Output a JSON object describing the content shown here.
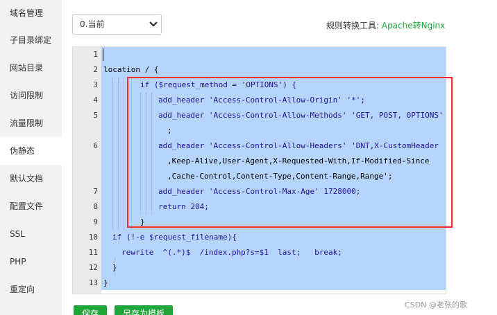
{
  "sidebar": {
    "items": [
      {
        "label": "域名管理"
      },
      {
        "label": "子目录绑定"
      },
      {
        "label": "网站目录"
      },
      {
        "label": "访问限制"
      },
      {
        "label": "流量限制"
      },
      {
        "label": "伪静态",
        "active": true
      },
      {
        "label": "默认文档"
      },
      {
        "label": "配置文件"
      },
      {
        "label": "SSL"
      },
      {
        "label": "PHP"
      },
      {
        "label": "重定向"
      }
    ]
  },
  "toolbar": {
    "template_select": {
      "value": "0.当前"
    },
    "tool_label": "规则转换工具: ",
    "tool_link": "Apache转Nginx"
  },
  "editor": {
    "line_numbers": [
      "1",
      "2",
      "3",
      "4",
      "5",
      "6",
      "7",
      "8",
      "9",
      "10",
      "11",
      "12",
      "13"
    ],
    "lines": [
      "location / {",
      "if ($request_method = 'OPTIONS') {",
      "add_header 'Access-Control-Allow-Origin' '*';",
      "add_header 'Access-Control-Allow-Methods' 'GET, POST, OPTIONS'",
      ";",
      "add_header 'Access-Control-Allow-Headers' 'DNT,X-CustomHeader",
      ",Keep-Alive,User-Agent,X-Requested-With,If-Modified-Since",
      ",Cache-Control,Content-Type,Content-Range,Range';",
      "add_header 'Access-Control-Max-Age' 1728000;",
      "return 204;",
      "}",
      "if (!-e $request_filename){",
      "rewrite  ^(.*)$  /index.php?s=$1  last;   break;",
      "}",
      "}"
    ]
  },
  "buttons": {
    "save_label": "保存",
    "save_template_label": "另存为模板"
  },
  "watermark": "CSDN @老张的歌",
  "colors": {
    "accent": "#20a53a",
    "selection": "#b5d5ff",
    "annotation_box": "#ff2a2a"
  }
}
